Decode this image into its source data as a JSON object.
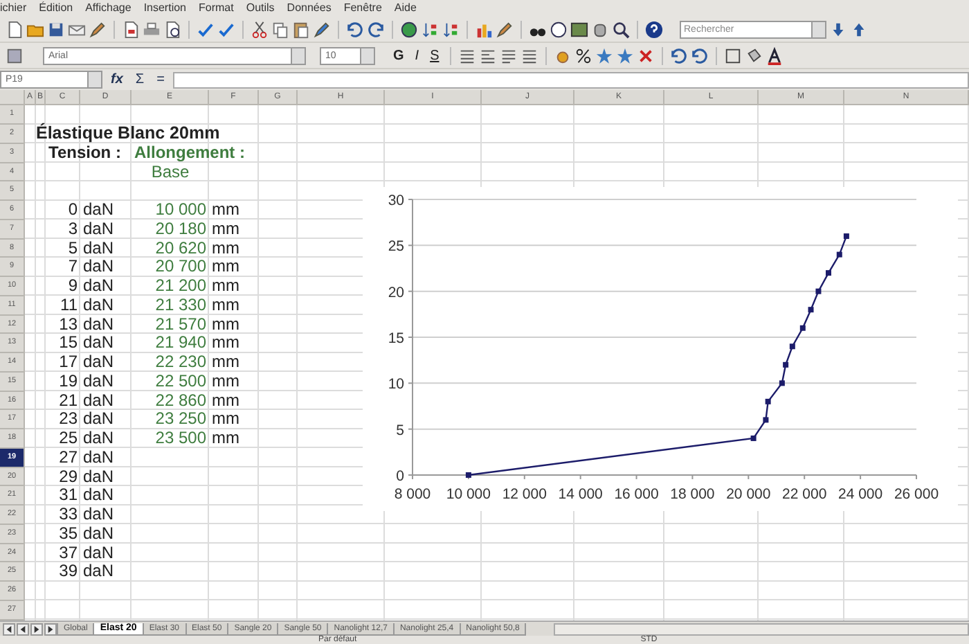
{
  "menu": [
    "ichier",
    "Édition",
    "Affichage",
    "Insertion",
    "Format",
    "Outils",
    "Données",
    "Fenêtre",
    "Aide"
  ],
  "search": {
    "placeholder": "Rechercher"
  },
  "format_bar": {
    "font": "Arial",
    "size": "10",
    "bold": "G",
    "italic": "I",
    "underline": "S"
  },
  "formula_bar": {
    "cell": "P19",
    "function_glyph": "fx",
    "sum_glyph": "Σ",
    "equals_glyph": "="
  },
  "columns": [
    "A",
    "B",
    "C",
    "D",
    "E",
    "F",
    "G",
    "H",
    "I",
    "J",
    "K",
    "L",
    "M",
    "N"
  ],
  "rows": [
    {
      "number": "1",
      "selected": false
    },
    {
      "number": "2",
      "selected": false,
      "title": "Élastique Blanc 20mm"
    },
    {
      "number": "3",
      "selected": false,
      "tension_heading": "Tension :",
      "length_heading": "Allongement :"
    },
    {
      "number": "4",
      "selected": false,
      "base_label": "Base"
    },
    {
      "number": "5",
      "selected": false
    },
    {
      "number": "6",
      "selected": false,
      "tension": "0",
      "tension_unit": "daN",
      "length": "10 000",
      "length_unit": "mm"
    },
    {
      "number": "7",
      "selected": false,
      "tension": "3",
      "tension_unit": "daN",
      "length": "20 180",
      "length_unit": "mm"
    },
    {
      "number": "8",
      "selected": false,
      "tension": "5",
      "tension_unit": "daN",
      "length": "20 620",
      "length_unit": "mm"
    },
    {
      "number": "9",
      "selected": false,
      "tension": "7",
      "tension_unit": "daN",
      "length": "20 700",
      "length_unit": "mm"
    },
    {
      "number": "10",
      "selected": false,
      "tension": "9",
      "tension_unit": "daN",
      "length": "21 200",
      "length_unit": "mm"
    },
    {
      "number": "11",
      "selected": false,
      "tension": "11",
      "tension_unit": "daN",
      "length": "21 330",
      "length_unit": "mm"
    },
    {
      "number": "12",
      "selected": false,
      "tension": "13",
      "tension_unit": "daN",
      "length": "21 570",
      "length_unit": "mm"
    },
    {
      "number": "13",
      "selected": false,
      "tension": "15",
      "tension_unit": "daN",
      "length": "21 940",
      "length_unit": "mm"
    },
    {
      "number": "14",
      "selected": false,
      "tension": "17",
      "tension_unit": "daN",
      "length": "22 230",
      "length_unit": "mm"
    },
    {
      "number": "15",
      "selected": false,
      "tension": "19",
      "tension_unit": "daN",
      "length": "22 500",
      "length_unit": "mm"
    },
    {
      "number": "16",
      "selected": false,
      "tension": "21",
      "tension_unit": "daN",
      "length": "22 860",
      "length_unit": "mm"
    },
    {
      "number": "17",
      "selected": false,
      "tension": "23",
      "tension_unit": "daN",
      "length": "23 250",
      "length_unit": "mm"
    },
    {
      "number": "18",
      "selected": false,
      "tension": "25",
      "tension_unit": "daN",
      "length": "23 500",
      "length_unit": "mm"
    },
    {
      "number": "19",
      "selected": true,
      "tension": "27",
      "tension_unit": "daN"
    },
    {
      "number": "20",
      "selected": false,
      "tension": "29",
      "tension_unit": "daN"
    },
    {
      "number": "21",
      "selected": false,
      "tension": "31",
      "tension_unit": "daN"
    },
    {
      "number": "22",
      "selected": false,
      "tension": "33",
      "tension_unit": "daN"
    },
    {
      "number": "23",
      "selected": false,
      "tension": "35",
      "tension_unit": "daN"
    },
    {
      "number": "24",
      "selected": false,
      "tension": "37",
      "tension_unit": "daN"
    },
    {
      "number": "25",
      "selected": false,
      "tension": "39",
      "tension_unit": "daN"
    },
    {
      "number": "26",
      "selected": false
    },
    {
      "number": "27",
      "selected": false
    }
  ],
  "chart_data": {
    "type": "line",
    "grid": true,
    "x": [
      10000,
      20180,
      20620,
      20700,
      21200,
      21330,
      21570,
      21940,
      22230,
      22500,
      22860,
      23250,
      23500
    ],
    "series": [
      {
        "color": "#1c1c6a",
        "marker": true,
        "values": [
          0,
          4,
          6,
          8,
          10,
          12,
          14,
          16,
          18,
          20,
          22,
          24,
          26
        ]
      }
    ],
    "xlim": [
      8000,
      26000
    ],
    "ylim": [
      0,
      30
    ],
    "xticks": [
      {
        "value": 8000,
        "label": "8 000"
      },
      {
        "value": 10000,
        "label": "10 000"
      },
      {
        "value": 12000,
        "label": "12 000"
      },
      {
        "value": 14000,
        "label": "14 000"
      },
      {
        "value": 16000,
        "label": "16 000"
      },
      {
        "value": 18000,
        "label": "18 000"
      },
      {
        "value": 20000,
        "label": "20 000"
      },
      {
        "value": 22000,
        "label": "22 000"
      },
      {
        "value": 24000,
        "label": "24 000"
      },
      {
        "value": 26000,
        "label": "26 000"
      }
    ],
    "yticks": [
      {
        "value": 0,
        "label": "0"
      },
      {
        "value": 5,
        "label": "5"
      },
      {
        "value": 10,
        "label": "10"
      },
      {
        "value": 15,
        "label": "15"
      },
      {
        "value": 20,
        "label": "20"
      },
      {
        "value": 25,
        "label": "25"
      },
      {
        "value": 30,
        "label": "30"
      }
    ]
  },
  "sheet_tabs": [
    {
      "label": "Global",
      "selected": false
    },
    {
      "label": "Elast 20",
      "selected": true
    },
    {
      "label": "Elast 30",
      "selected": false
    },
    {
      "label": "Elast 50",
      "selected": false
    },
    {
      "label": "Sangle 20",
      "selected": false
    },
    {
      "label": "Sangle 50",
      "selected": false
    },
    {
      "label": "Nanolight 12,7",
      "selected": false
    },
    {
      "label": "Nanolight 25,4",
      "selected": false
    },
    {
      "label": "Nanolight 50,8",
      "selected": false
    }
  ],
  "status_bar": {
    "style": "Par défaut",
    "mode": "STD"
  }
}
